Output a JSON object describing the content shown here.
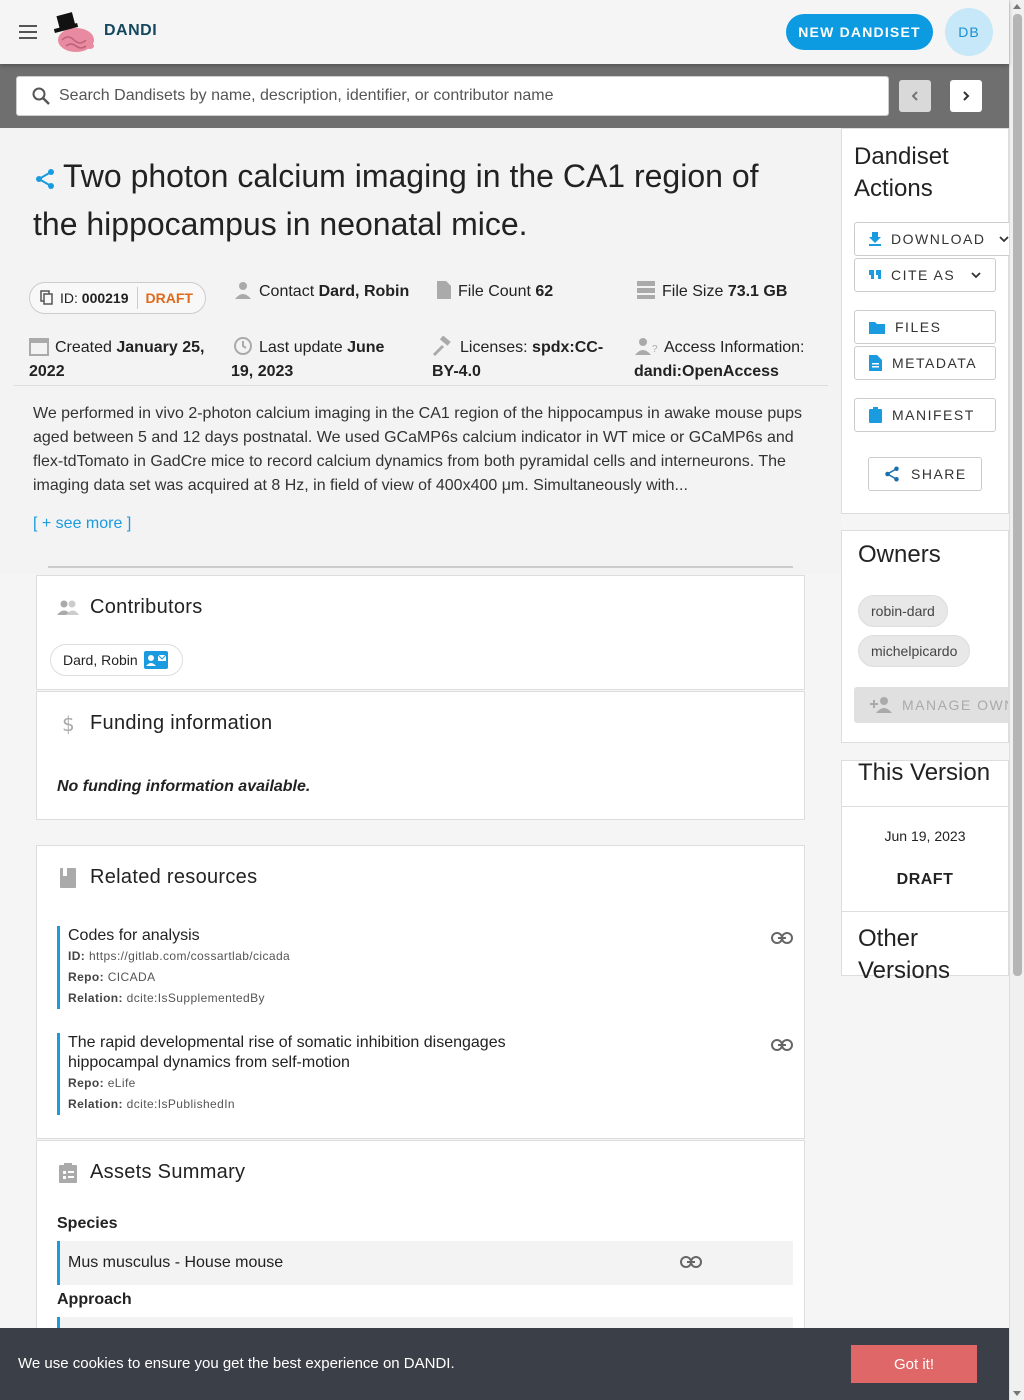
{
  "app": {
    "brand": "DANDI",
    "new_dandiset_label": "NEW DANDISET",
    "avatar_initials": "DB"
  },
  "search": {
    "placeholder": "Search Dandisets by name, description, identifier, or contributor name"
  },
  "dandiset": {
    "title": "Two photon calcium imaging in the CA1 region of the hippocampus in neonatal mice.",
    "id_label": "ID:",
    "id": "000219",
    "status": "DRAFT",
    "contact_label": "Contact",
    "contact": "Dard, Robin",
    "file_count_label": "File Count",
    "file_count": "62",
    "file_size_label": "File Size",
    "file_size": "73.1 GB",
    "created_label": "Created",
    "created": "January 25, 2022",
    "last_update_label": "Last update",
    "last_update": "June 19, 2023",
    "licenses_label": "Licenses:",
    "licenses": "spdx:CC-BY-4.0",
    "access_label": "Access Information:",
    "access": "dandi:OpenAccess",
    "description": "We performed in vivo 2-photon calcium imaging in the CA1 region of the hippocampus in awake mouse pups aged between 5 and 12 days postnatal. We used GCaMP6s calcium indicator in WT mice or GCaMP6s and flex-tdTomato in GadCre mice to record calcium dynamics from both pyramidal cells and interneurons. The imaging data set was acquired at 8 Hz, in field of view of 400x400 μm. Simultaneously with...",
    "see_more": "[ + see more ]"
  },
  "contributors": {
    "heading": "Contributors",
    "items": [
      "Dard, Robin"
    ]
  },
  "funding": {
    "heading": "Funding information",
    "empty": "No funding information available."
  },
  "related": {
    "heading": "Related resources",
    "items": [
      {
        "title": "Codes for analysis",
        "id_label": "ID:",
        "id": "https://gitlab.com/cossartlab/cicada",
        "repo_label": "Repo:",
        "repo": "CICADA",
        "relation_label": "Relation:",
        "relation": "dcite:IsSupplementedBy"
      },
      {
        "title": "The rapid developmental rise of somatic inhibition disengages hippocampal dynamics from self-motion",
        "repo_label": "Repo:",
        "repo": "eLife",
        "relation_label": "Relation:",
        "relation": "dcite:IsPublishedIn"
      }
    ]
  },
  "assets_summary": {
    "heading": "Assets Summary",
    "species_label": "Species",
    "species": [
      "Mus musculus - House mouse"
    ],
    "approach_label": "Approach"
  },
  "actions": {
    "heading": "Dandiset Actions",
    "download": "DOWNLOAD",
    "cite_as": "CITE AS",
    "files": "FILES",
    "metadata": "METADATA",
    "manifest": "MANIFEST",
    "share": "SHARE"
  },
  "owners": {
    "heading": "Owners",
    "items": [
      "robin-dard",
      "michelpicardo"
    ],
    "manage": "MANAGE OWNERS"
  },
  "this_version": {
    "heading": "This Version",
    "date": "Jun 19, 2023",
    "label": "DRAFT"
  },
  "other_versions": {
    "heading": "Other Versions"
  },
  "cookie": {
    "text": "We use cookies to ensure you get the best experience on DANDI.",
    "button": "Got it!"
  },
  "colors": {
    "primary": "#0c9ae0",
    "accent_blue": "#1a9be0",
    "draft_orange": "#e06a1b",
    "cookie_bg": "#3b3f47",
    "cookie_button": "#e06767"
  },
  "icons": [
    "menu-icon",
    "dandi-logo",
    "search-icon",
    "chevron-left-icon",
    "chevron-right-icon",
    "share-icon",
    "copy-icon",
    "person-icon",
    "file-icon",
    "storage-icon",
    "calendar-icon",
    "history-icon",
    "gavel-icon",
    "access-icon",
    "group-icon",
    "dollar-icon",
    "book-icon",
    "clipboard-icon",
    "contact-mail-icon",
    "link-icon",
    "download-icon",
    "quote-icon",
    "folder-icon",
    "document-icon",
    "manifest-icon",
    "add-person-icon",
    "chevron-down-icon"
  ]
}
